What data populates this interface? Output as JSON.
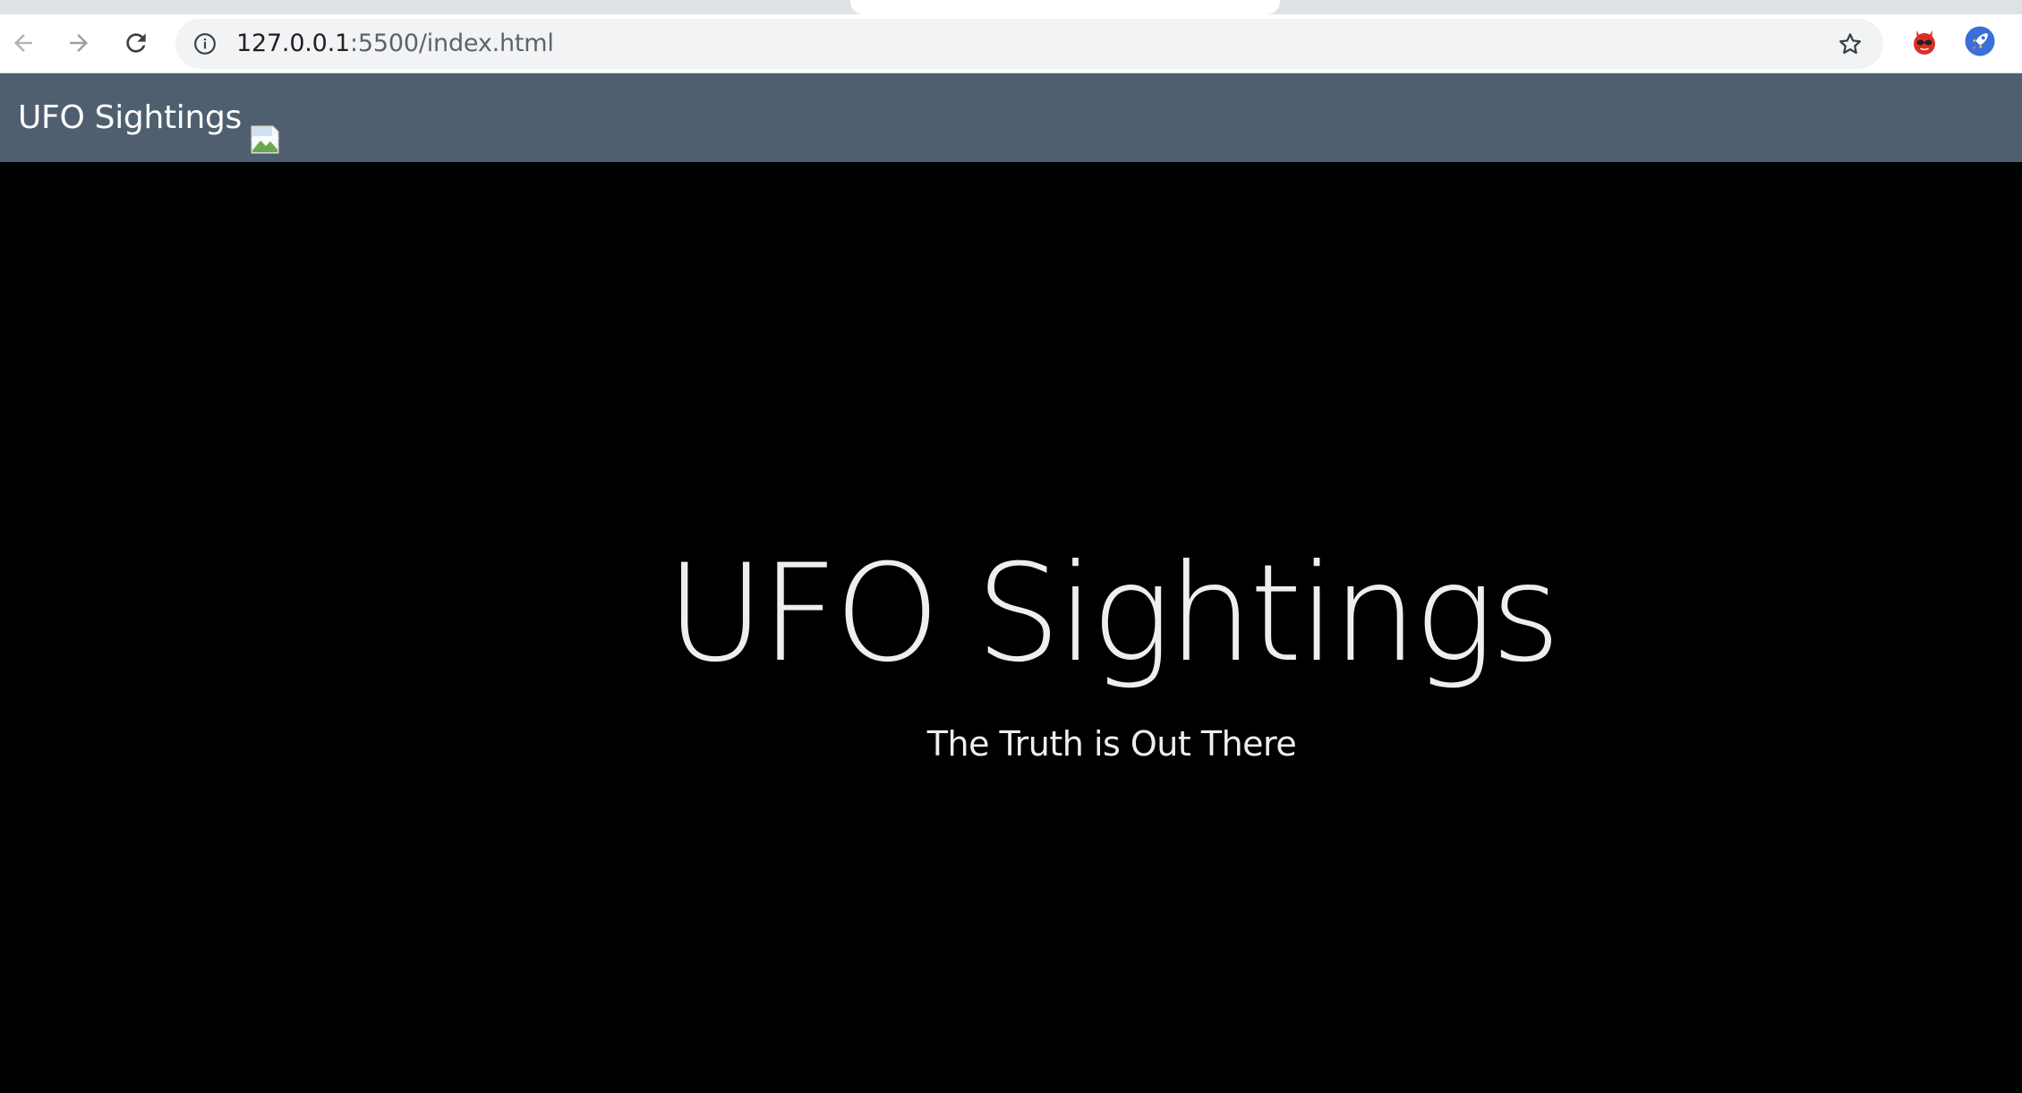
{
  "browser": {
    "url_host": "127.0.0.1",
    "url_rest": ":5500/index.html",
    "colors": {
      "chrome_bg": "#ffffff",
      "omnibox_bg": "#f1f3f4",
      "tabstrip_bg": "#dee1e6",
      "icon": "#5f6368"
    },
    "icons": [
      "back-arrow-icon",
      "forward-arrow-icon",
      "reload-icon",
      "site-info-icon",
      "bookmark-star-icon",
      "devil-extension-icon",
      "rocket-extension-icon"
    ]
  },
  "navbar": {
    "brand": "UFO Sightings",
    "bg_color": "#4f5f6f",
    "image": "broken-image-icon"
  },
  "hero": {
    "title": "UFO Sightings",
    "subtitle": "The Truth is Out There",
    "bg_color": "#000000",
    "text_color": "#eeeeee"
  }
}
